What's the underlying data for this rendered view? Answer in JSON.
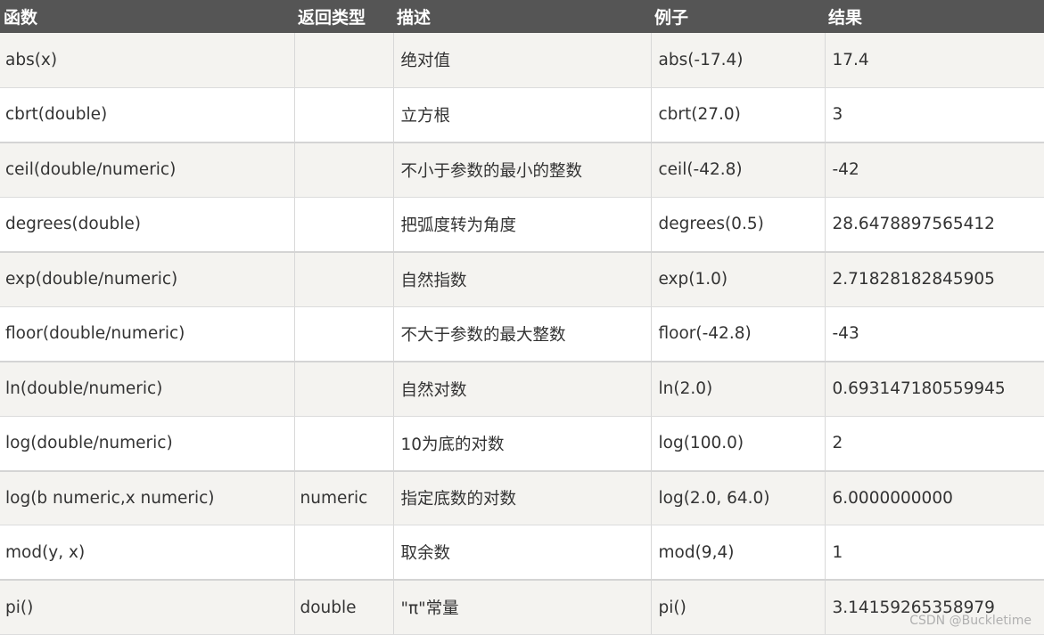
{
  "table": {
    "headers": [
      "函数",
      "返回类型",
      "描述",
      "例子",
      "结果"
    ],
    "rows": [
      [
        "abs(x)",
        "",
        "绝对值",
        "abs(-17.4)",
        "17.4"
      ],
      [
        "cbrt(double)",
        "",
        "立方根",
        "cbrt(27.0)",
        "3"
      ],
      [
        "ceil(double/numeric)",
        "",
        "不小于参数的最小的整数",
        "ceil(-42.8)",
        "-42"
      ],
      [
        "degrees(double)",
        "",
        "把弧度转为角度",
        "degrees(0.5)",
        "28.6478897565412"
      ],
      [
        "exp(double/numeric)",
        "",
        "自然指数",
        "exp(1.0)",
        "2.71828182845905"
      ],
      [
        "floor(double/numeric)",
        "",
        "不大于参数的最大整数",
        "floor(-42.8)",
        "-43"
      ],
      [
        "ln(double/numeric)",
        "",
        "自然对数",
        "ln(2.0)",
        "0.693147180559945"
      ],
      [
        "log(double/numeric)",
        "",
        "10为底的对数",
        "log(100.0)",
        "2"
      ],
      [
        "log(b numeric,x numeric)",
        "numeric",
        "指定底数的对数",
        "log(2.0, 64.0)",
        "6.0000000000"
      ],
      [
        "mod(y, x)",
        "",
        "取余数",
        "mod(9,4)",
        "1"
      ],
      [
        "pi()",
        "double",
        "\"π\"常量",
        "pi()",
        "3.14159265358979"
      ]
    ]
  },
  "watermark": "CSDN @Buckletime",
  "colors": {
    "header_bg": "#555555",
    "header_text": "#ffffff",
    "row_odd_bg": "#f4f3f0",
    "row_even_bg": "#ffffff",
    "cell_text": "#333333"
  }
}
